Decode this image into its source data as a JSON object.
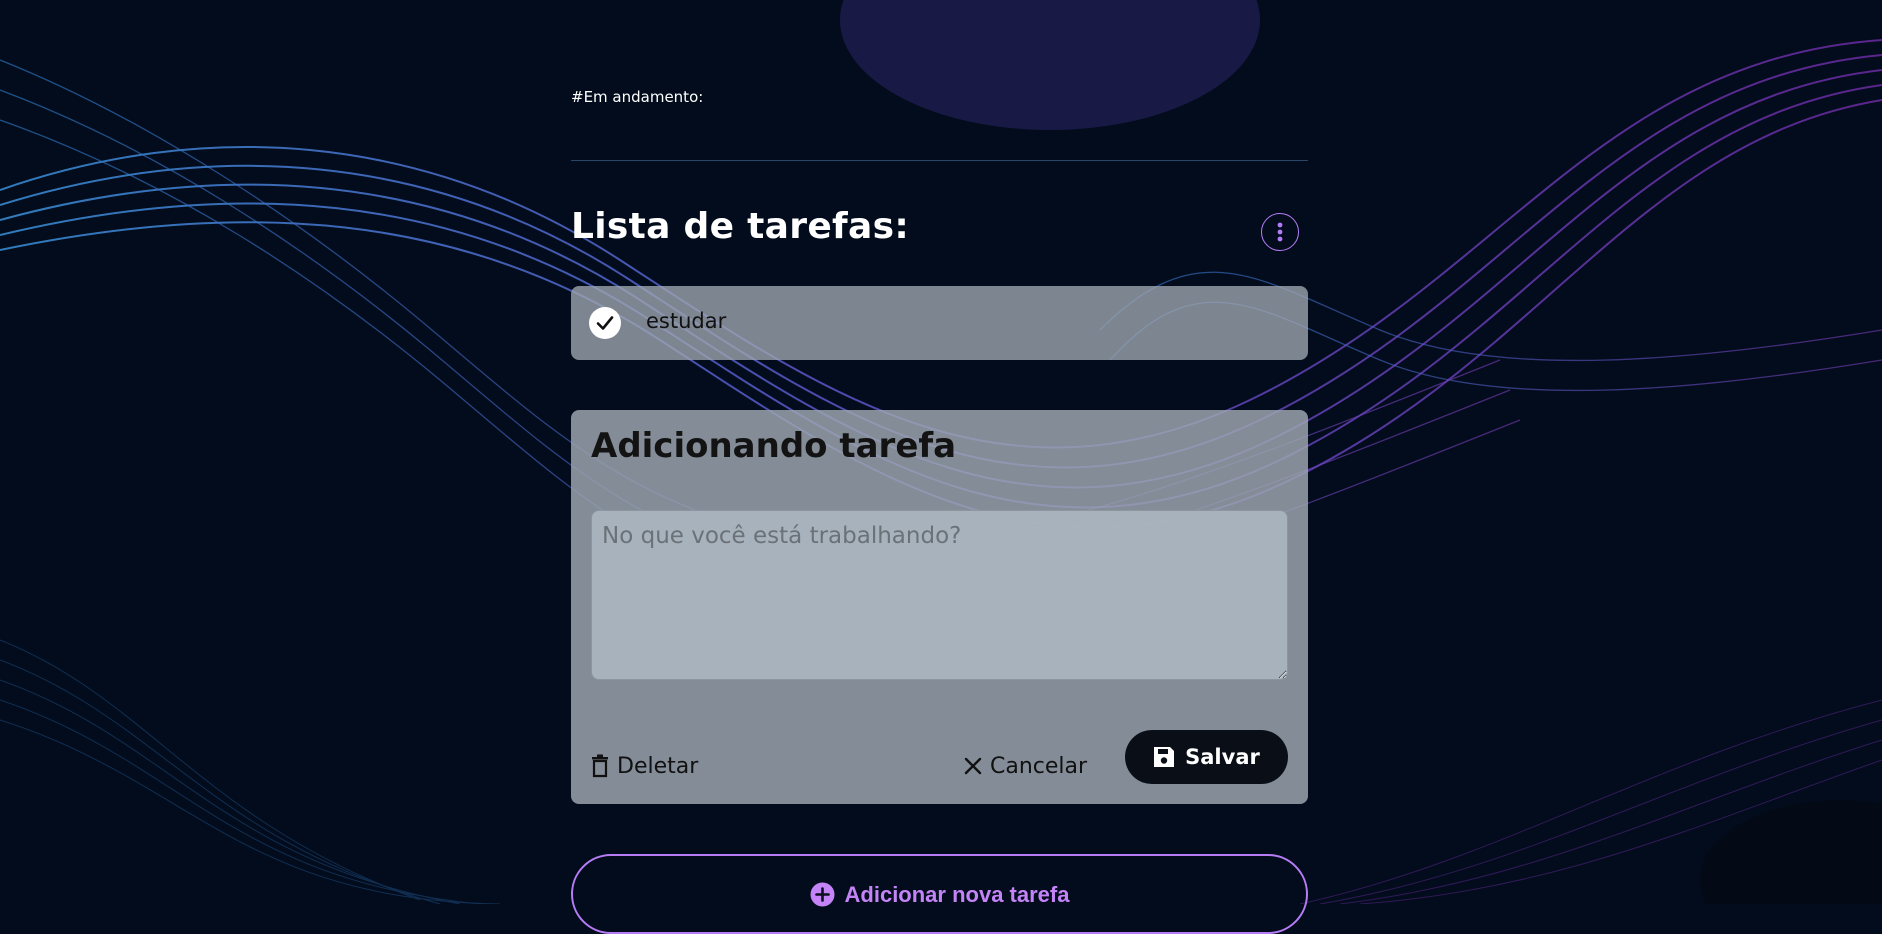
{
  "status": {
    "label": "#Em andamento:"
  },
  "list": {
    "title": "Lista de tarefas:",
    "menu_icon": "more-vertical-icon",
    "items": [
      {
        "label": "estudar",
        "icon": "check-circle-icon"
      }
    ]
  },
  "form": {
    "title": "Adicionando tarefa",
    "input_placeholder": "No que você está trabalhando?",
    "delete_label": "Deletar",
    "cancel_label": "Cancelar",
    "save_label": "Salvar",
    "delete_icon": "trash-icon",
    "cancel_icon": "close-icon",
    "save_icon": "floppy-disk-icon"
  },
  "add_task": {
    "label": "Adicionar nova tarefa",
    "icon": "plus-circle-icon"
  },
  "colors": {
    "background": "#020c1c",
    "accent": "#b67cf5",
    "card": "#a0a8b2",
    "save_button": "#0a0f17"
  }
}
